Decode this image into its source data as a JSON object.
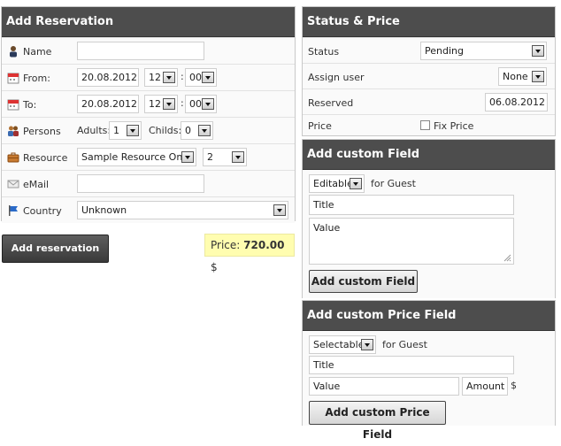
{
  "reservation": {
    "title": "Add Reservation",
    "name_label": "Name",
    "name_value": "",
    "from_label": "From:",
    "from_date": "20.08.2012",
    "from_hour": "12",
    "from_min": "00",
    "to_label": "To:",
    "to_date": "20.08.2012",
    "to_hour": "12",
    "to_min": "00",
    "colon": ":",
    "persons_label": "Persons",
    "adults_label": "Adults:",
    "adults_value": "1",
    "childs_label": "Childs:",
    "childs_value": "0",
    "resource_label": "Resource",
    "resource_value": "Sample Resource One",
    "resource_count": "2",
    "email_label": "eMail",
    "email_value": "",
    "country_label": "Country",
    "country_value": "Unknown",
    "submit_label": "Add reservation",
    "price_label": "Price:",
    "price_value": "720.00",
    "price_currency": "$"
  },
  "status": {
    "title": "Status & Price",
    "status_label": "Status",
    "status_value": "Pending",
    "assign_label": "Assign user",
    "assign_value": "None",
    "reserved_label": "Reserved",
    "reserved_value": "06.08.2012",
    "price_label": "Price",
    "fix_price_label": "Fix Price"
  },
  "custom_field": {
    "title": "Add custom Field",
    "type_value": "Editable",
    "for_label": "for Guest",
    "title_placeholder": "Title",
    "value_placeholder": "Value",
    "button_label": "Add custom Field"
  },
  "custom_price": {
    "title": "Add custom Price Field",
    "type_value": "Selectable",
    "for_label": "for Guest",
    "title_placeholder": "Title",
    "value_placeholder": "Value",
    "amount_placeholder": "Amount",
    "currency": "$",
    "button_label": "Add custom Price Field"
  }
}
